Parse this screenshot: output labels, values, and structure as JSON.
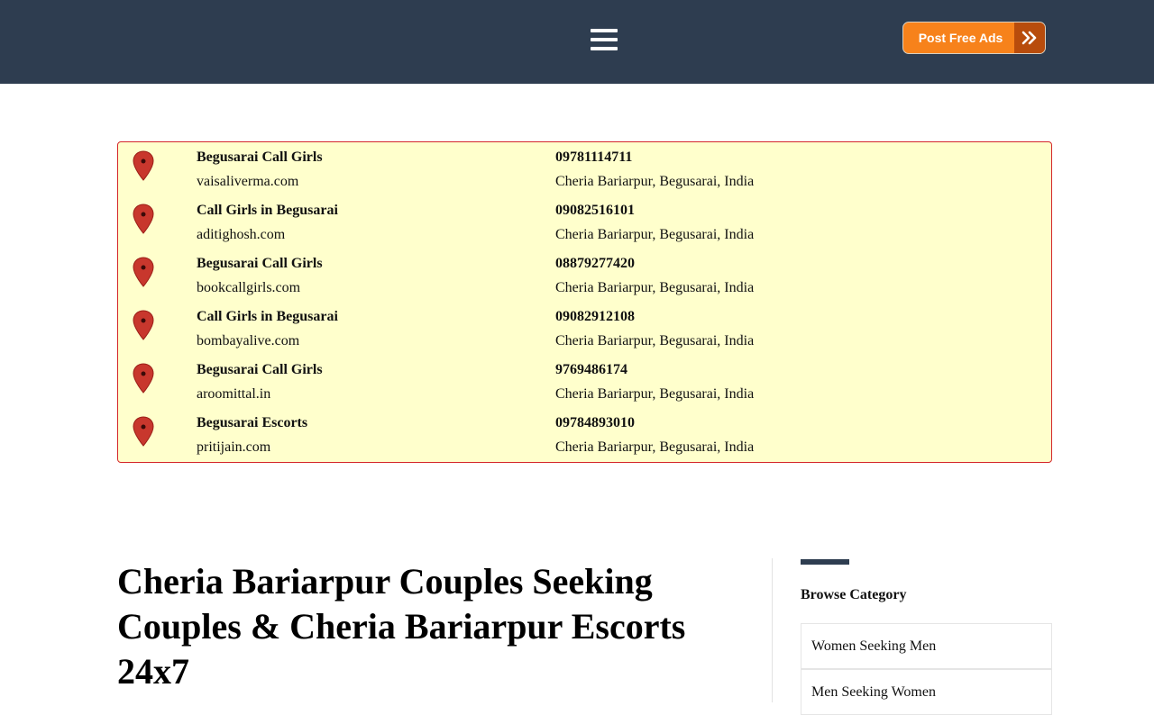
{
  "header": {
    "post_button_label": "Post Free Ads"
  },
  "listings": [
    {
      "name": "Begusarai Call Girls",
      "site": "vaisaliverma.com",
      "phone": "09781114711",
      "location": "Cheria Bariarpur, Begusarai, India"
    },
    {
      "name": "Call Girls in Begusarai",
      "site": "aditighosh.com",
      "phone": "09082516101",
      "location": "Cheria Bariarpur, Begusarai, India"
    },
    {
      "name": "Begusarai Call Girls",
      "site": "bookcallgirls.com",
      "phone": "08879277420",
      "location": "Cheria Bariarpur, Begusarai, India"
    },
    {
      "name": "Call Girls in Begusarai",
      "site": "bombayalive.com",
      "phone": "09082912108",
      "location": "Cheria Bariarpur, Begusarai, India"
    },
    {
      "name": "Begusarai Call Girls",
      "site": "aroomittal.in",
      "phone": "9769486174",
      "location": "Cheria Bariarpur, Begusarai, India"
    },
    {
      "name": "Begusarai Escorts",
      "site": "pritijain.com",
      "phone": "09784893010",
      "location": "Cheria Bariarpur, Begusarai, India"
    }
  ],
  "main": {
    "title": "Cheria Bariarpur Couples Seeking Couples & Cheria Bariarpur Escorts 24x7"
  },
  "sidebar": {
    "heading": "Browse Category",
    "categories": [
      "Women Seeking Men",
      "Men Seeking Women"
    ]
  },
  "colors": {
    "header_bg": "#2e3d50",
    "button_orange": "#f7821b",
    "listing_bg": "#ffffcc",
    "listing_border": "#d4262a",
    "pin_red": "#c8372d"
  }
}
